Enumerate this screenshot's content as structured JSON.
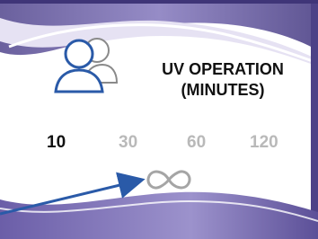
{
  "panel": {
    "title_line1": "UV OPERATION",
    "title_line2": "(MINUTES)"
  },
  "durations": [
    {
      "label": "10",
      "selected": true
    },
    {
      "label": "30",
      "selected": false
    },
    {
      "label": "60",
      "selected": false
    },
    {
      "label": "120",
      "selected": false
    }
  ],
  "continuous_option": {
    "symbol": "∞",
    "icon": "infinity-icon"
  },
  "colors": {
    "accent_purple": "#6b5ea8",
    "frame_dark": "#5a4f93",
    "selected_text": "#111111",
    "unselected_text": "#b9b9b9",
    "arrow": "#2a5aa8"
  },
  "icons": [
    "user-profile-icon",
    "infinity-icon",
    "pointer-arrow"
  ]
}
